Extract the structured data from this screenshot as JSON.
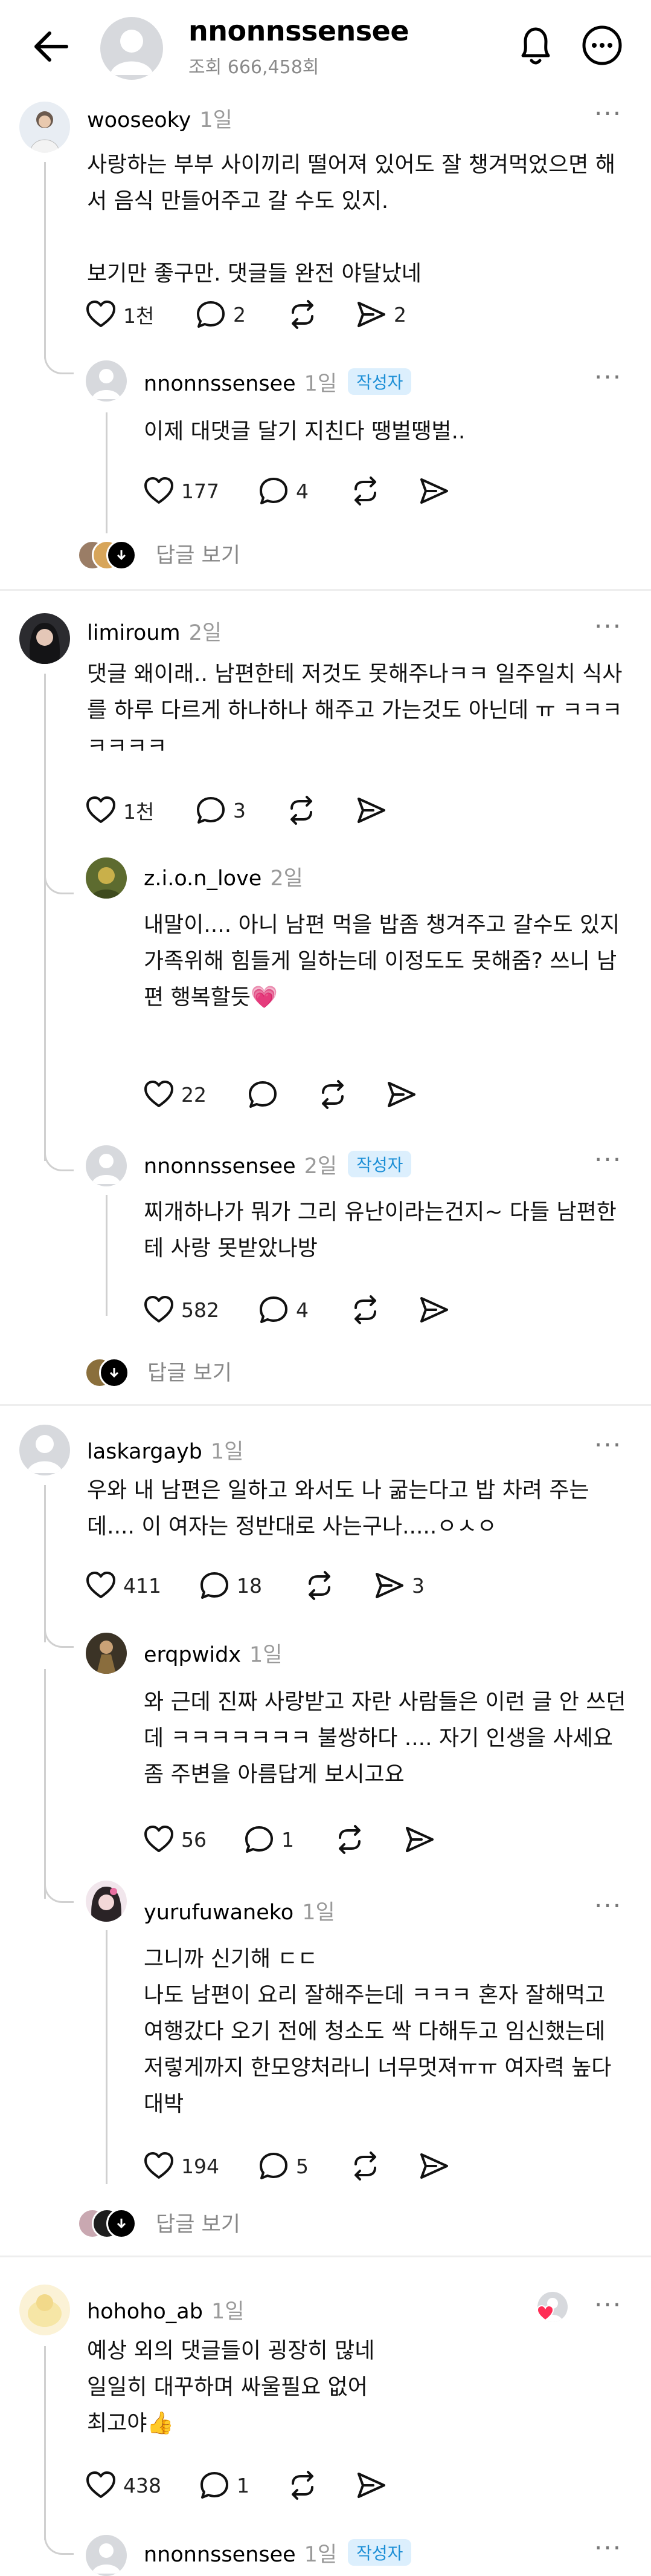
{
  "header": {
    "title": "nnonnssensee",
    "views": "조회 666,458회"
  },
  "comments": [
    {
      "user": "wooseoky",
      "time": "1일",
      "body": "사랑하는 부부 사이끼리 떨어져 있어도 잘 챙겨먹었으면 해서 음식 만들어주고 갈 수도 있지.\n\n보기만 좋구만. 댓글들 완전 야달났네",
      "likes": "1천",
      "replies": "2",
      "reposts": "",
      "shares": "2",
      "more_replies": "답글 보기",
      "sub": [
        {
          "user": "nnonnssensee",
          "time": "1일",
          "badge": "작성자",
          "body": "이제 대댓글 달기 지친다 땡벌땡벌..",
          "likes": "177",
          "replies": "4",
          "shares": ""
        }
      ]
    },
    {
      "user": "limiroum",
      "time": "2일",
      "body": "댓글 왜이래.. 남편한테 저것도 못해주나ㅋㅋ 일주일치 식사를 하루 다르게 하나하나 해주고 가는것도 아닌데 ㅠ ㅋㅋㅋㅋㅋㅋㅋ",
      "likes": "1천",
      "replies": "3",
      "reposts": "",
      "shares": "",
      "more_replies": "답글 보기",
      "sub": [
        {
          "user": "z.i.o.n_love",
          "time": "2일",
          "badge": "",
          "body": "내말이.... 아니 남편 먹을 밥좀 챙겨주고 갈수도 있지\n가족위해 힘들게 일하는데 이정도도 못해줌? 쓰니 남편 행복할듯💗",
          "likes": "22",
          "replies": "",
          "shares": ""
        },
        {
          "user": "nnonnssensee",
          "time": "2일",
          "badge": "작성자",
          "body": "찌개하나가 뭐가 그리 유난이라는건지~  다들 남편한테 사랑 못받았나방",
          "likes": "582",
          "replies": "4",
          "shares": ""
        }
      ]
    },
    {
      "user": "laskargayb",
      "time": "1일",
      "body": "우와 내 남편은 일하고 와서도 나 굶는다고 밥 차려 주는데.... 이 여자는 정반대로 사는구나.....ㅇㅅㅇ",
      "likes": "411",
      "replies": "18",
      "reposts": "",
      "shares": "3",
      "more_replies": "답글 보기",
      "sub": [
        {
          "user": "erqpwidx",
          "time": "1일",
          "badge": "",
          "body": "와 근데 진짜 사랑받고 자란 사람들은 이런 글 안 쓰던데 ㅋㅋㅋㅋㅋㅋㅋ 불쌍하다 .... 자기 인생을 사세요 좀 주변을 아름답게 보시고요",
          "likes": "56",
          "replies": "1",
          "shares": ""
        },
        {
          "user": "yurufuwaneko",
          "time": "1일",
          "badge": "",
          "body": "그니까 신기해 ㄷㄷ\n나도 남편이 요리 잘해주는데 ㅋㅋㅋ 혼자 잘해먹고 여행갔다 오기 전에 청소도 싹 다해두고 임신했는데 저렇게까지 한모양처라니 너무멋져ㅠㅠ 여자력 높다 대박",
          "likes": "194",
          "replies": "5",
          "shares": ""
        }
      ]
    },
    {
      "user": "hohoho_ab",
      "time": "1일",
      "body": "예상 외의 댓글들이 굉장히 많네\n일일히 대꾸하며 싸울필요 없어\n최고야👍",
      "likes": "438",
      "replies": "1",
      "reposts": "",
      "shares": "",
      "sub": [
        {
          "user": "nnonnssensee",
          "time": "1일",
          "badge": "작성자"
        }
      ]
    }
  ],
  "colors": {
    "badge_bg": "#dceffd",
    "badge_text": "#1d8fd6",
    "muted": "#9a9a9a",
    "thread": "#d0d0d0"
  }
}
